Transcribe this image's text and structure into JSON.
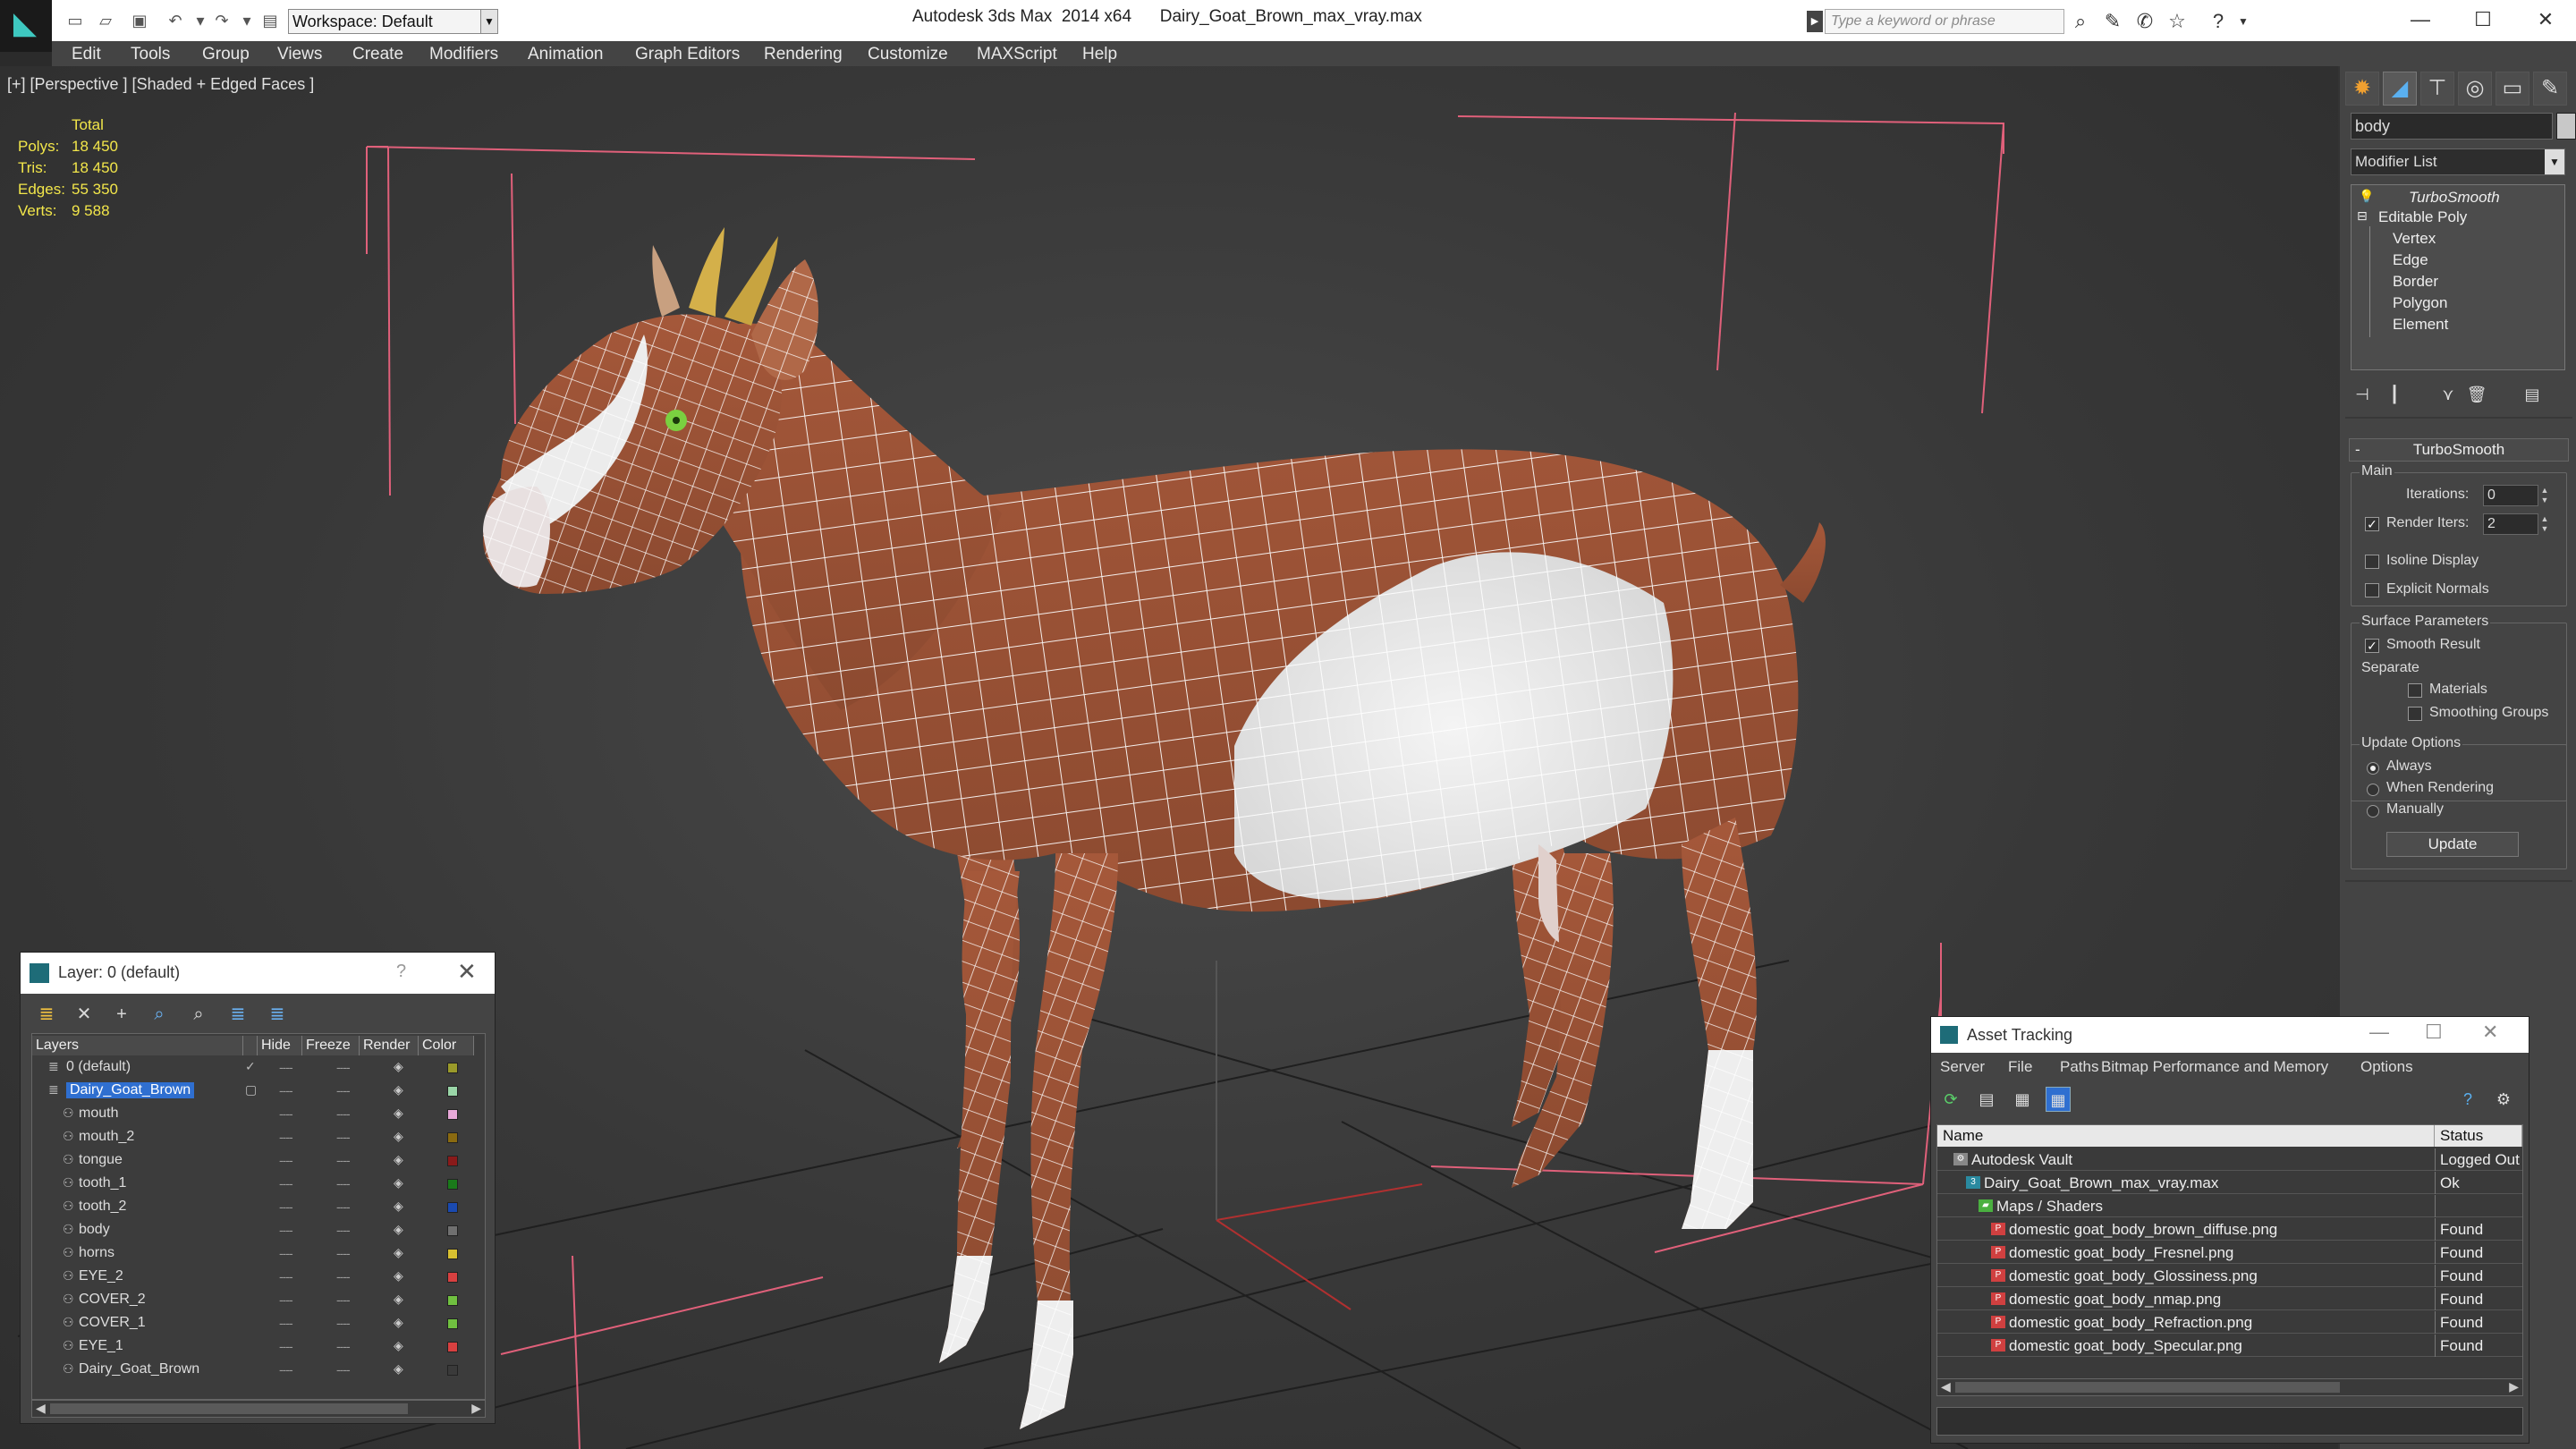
{
  "app": {
    "title": "Autodesk 3ds Max  2014 x64",
    "filename": "Dairy_Goat_Brown_max_vray.max",
    "workspace": "Workspace: Default",
    "search_placeholder": "Type a keyword or phrase"
  },
  "menu": [
    "Edit",
    "Tools",
    "Group",
    "Views",
    "Create",
    "Modifiers",
    "Animation",
    "Graph Editors",
    "Rendering",
    "Customize",
    "MAXScript",
    "Help"
  ],
  "viewport": {
    "label": "[+] [Perspective ] [Shaded + Edged Faces ]",
    "stats": {
      "header": "Total",
      "rows": [
        {
          "k": "Polys:",
          "v": "18 450"
        },
        {
          "k": "Tris:",
          "v": "18 450"
        },
        {
          "k": "Edges:",
          "v": "55 350"
        },
        {
          "k": "Verts:",
          "v": "9 588"
        }
      ]
    }
  },
  "command_panel": {
    "object_name": "body",
    "modifier_list": "Modifier List",
    "stack": {
      "turbosmooth": "TurboSmooth",
      "editable_poly": "Editable Poly",
      "subobjects": [
        "Vertex",
        "Edge",
        "Border",
        "Polygon",
        "Element"
      ]
    },
    "rollout_title": "TurboSmooth",
    "main_group": "Main",
    "iterations_label": "Iterations:",
    "iterations_value": "0",
    "render_iters_label": "Render Iters:",
    "render_iters_value": "2",
    "isoline_label": "Isoline Display",
    "explicit_normals_label": "Explicit Normals",
    "surface_group": "Surface Parameters",
    "smooth_result_label": "Smooth Result",
    "separate_label": "Separate",
    "materials_label": "Materials",
    "smoothing_groups_label": "Smoothing Groups",
    "update_group": "Update Options",
    "always_label": "Always",
    "when_rendering_label": "When Rendering",
    "manually_label": "Manually",
    "update_button": "Update"
  },
  "layers": {
    "title": "Layer: 0 (default)",
    "help": "?",
    "columns": [
      "Layers",
      "Hide",
      "Freeze",
      "Render",
      "Color"
    ],
    "rows": [
      {
        "name": "0 (default)",
        "indent": 0,
        "color": "#9a9a2a",
        "current": true
      },
      {
        "name": "Dairy_Goat_Brown",
        "indent": 0,
        "color": "#9ad6a8",
        "selected": true
      },
      {
        "name": "mouth",
        "indent": 1,
        "color": "#e8a8d8"
      },
      {
        "name": "mouth_2",
        "indent": 1,
        "color": "#8a6a10"
      },
      {
        "name": "tongue",
        "indent": 1,
        "color": "#8a1a1a"
      },
      {
        "name": "tooth_1",
        "indent": 1,
        "color": "#1a7a1a"
      },
      {
        "name": "tooth_2",
        "indent": 1,
        "color": "#1a4ab0"
      },
      {
        "name": "body",
        "indent": 1,
        "color": "#707070"
      },
      {
        "name": "horns",
        "indent": 1,
        "color": "#d8c030"
      },
      {
        "name": "EYE_2",
        "indent": 1,
        "color": "#d84040"
      },
      {
        "name": "COVER_2",
        "indent": 1,
        "color": "#70c040"
      },
      {
        "name": "COVER_1",
        "indent": 1,
        "color": "#70c040"
      },
      {
        "name": "EYE_1",
        "indent": 1,
        "color": "#d84040"
      },
      {
        "name": "Dairy_Goat_Brown",
        "indent": 1,
        "color": "#3a3a3a"
      }
    ]
  },
  "asset_tracking": {
    "title": "Asset Tracking",
    "menu": [
      "Server",
      "File",
      "Paths",
      "Bitmap Performance and Memory",
      "Options"
    ],
    "columns": [
      "Name",
      "Status"
    ],
    "rows": [
      {
        "name": "Autodesk Vault",
        "status": "Logged Out",
        "indent": 0,
        "icon": "vault"
      },
      {
        "name": "Dairy_Goat_Brown_max_vray.max",
        "status": "Ok",
        "indent": 1,
        "icon": "max"
      },
      {
        "name": "Maps / Shaders",
        "status": "",
        "indent": 2,
        "icon": "maps"
      },
      {
        "name": "domestic goat_body_brown_diffuse.png",
        "status": "Found",
        "indent": 3,
        "icon": "png"
      },
      {
        "name": "domestic goat_body_Fresnel.png",
        "status": "Found",
        "indent": 3,
        "icon": "png"
      },
      {
        "name": "domestic goat_body_Glossiness.png",
        "status": "Found",
        "indent": 3,
        "icon": "png"
      },
      {
        "name": "domestic goat_body_nmap.png",
        "status": "Found",
        "indent": 3,
        "icon": "png"
      },
      {
        "name": "domestic goat_body_Refraction.png",
        "status": "Found",
        "indent": 3,
        "icon": "png"
      },
      {
        "name": "domestic goat_body_Specular.png",
        "status": "Found",
        "indent": 3,
        "icon": "png"
      }
    ]
  }
}
